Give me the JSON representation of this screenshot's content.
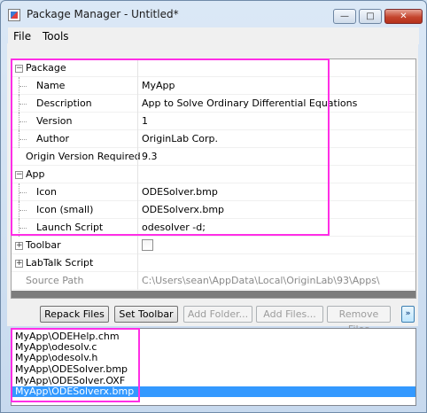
{
  "window": {
    "title": "Package Manager - Untitled*",
    "minimize_glyph": "—",
    "maximize_glyph": "□",
    "close_glyph": "✕"
  },
  "menu": {
    "file": "File",
    "tools": "Tools"
  },
  "properties": {
    "package_label": "Package",
    "name_label": "Name",
    "name_value": "MyApp",
    "description_label": "Description",
    "description_value": "App to Solve Ordinary Differential Equations",
    "version_label": "Version",
    "version_value": "1",
    "author_label": "Author",
    "author_value": "OriginLab Corp.",
    "origin_version_label": "Origin Version Required",
    "origin_version_value": "9.3",
    "app_label": "App",
    "icon_label": "Icon",
    "icon_value": "ODESolver.bmp",
    "icon_small_label": "Icon (small)",
    "icon_small_value": "ODESolverx.bmp",
    "launch_script_label": "Launch Script",
    "launch_script_value": "odesolver -d;",
    "toolbar_label": "Toolbar",
    "toolbar_checked": false,
    "labtalk_label": "LabTalk Script",
    "source_path_label": "Source Path",
    "source_path_value": "C:\\Users\\sean\\AppData\\Local\\OriginLab\\93\\Apps\\",
    "collapse_glyph": "−",
    "expand_glyph": "+"
  },
  "toolbar": {
    "repack": "Repack Files",
    "set_toolbar": "Set Toolbar",
    "add_folder": "Add Folder...",
    "add_files": "Add Files...",
    "remove_files": "Remove Files",
    "collapse_glyph": "»"
  },
  "files": [
    "MyApp\\ODEHelp.chm",
    "MyApp\\odesolv.c",
    "MyApp\\odesolv.h",
    "MyApp\\ODESolver.bmp",
    "MyApp\\ODESolver.OXF",
    "MyApp\\ODESolverx.bmp"
  ],
  "selected_file_index": 5,
  "colors": {
    "highlight": "#ff2ee6",
    "selection": "#3399ff"
  }
}
